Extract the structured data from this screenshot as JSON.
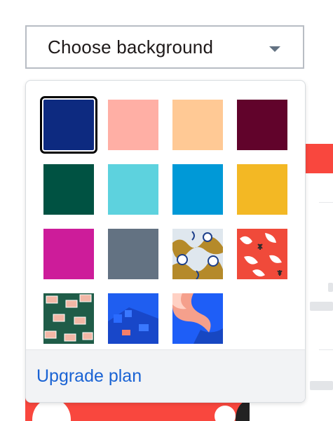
{
  "select": {
    "label": "Choose background",
    "caret_icon": "chevron-down-icon"
  },
  "menu": {
    "selected_index": 0,
    "swatches": [
      {
        "kind": "color",
        "color": "#0d2a80",
        "name": "navy"
      },
      {
        "kind": "color",
        "color": "#ffafa5",
        "name": "pink"
      },
      {
        "kind": "color",
        "color": "#ffc995",
        "name": "peach"
      },
      {
        "kind": "color",
        "color": "#61032b",
        "name": "wine"
      },
      {
        "kind": "color",
        "color": "#005242",
        "name": "forest"
      },
      {
        "kind": "color",
        "color": "#5dd2de",
        "name": "aqua"
      },
      {
        "kind": "color",
        "color": "#0099d7",
        "name": "ocean"
      },
      {
        "kind": "color",
        "color": "#f3b824",
        "name": "gold"
      },
      {
        "kind": "color",
        "color": "#cd1c9a",
        "name": "magenta"
      },
      {
        "kind": "color",
        "color": "#637282",
        "name": "slate"
      },
      {
        "kind": "pattern",
        "name": "cream-gold-pattern"
      },
      {
        "kind": "pattern",
        "name": "red-white-pattern"
      },
      {
        "kind": "pattern",
        "name": "green-boxes-pattern"
      },
      {
        "kind": "pattern",
        "name": "blue-blocks-pattern"
      },
      {
        "kind": "pattern",
        "name": "blue-swoosh-pattern"
      }
    ],
    "footer_link": "Upgrade plan"
  }
}
